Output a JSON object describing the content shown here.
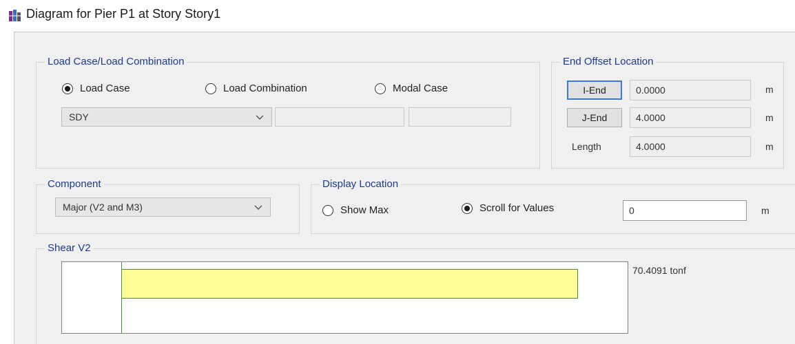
{
  "window": {
    "title": "Diagram for Pier P1 at Story Story1",
    "icon": "etabs-app-icon"
  },
  "load_case_group": {
    "legend": "Load Case/Load Combination",
    "options": [
      {
        "label": "Load Case",
        "selected": true
      },
      {
        "label": "Load Combination",
        "selected": false
      },
      {
        "label": "Modal Case",
        "selected": false
      }
    ],
    "case_select": {
      "value": "SDY"
    },
    "combo_field": {
      "value": ""
    },
    "modal_field": {
      "value": ""
    }
  },
  "end_offset": {
    "legend": "End Offset Location",
    "i_end": {
      "button": "I-End",
      "value": "0.0000",
      "unit": "m"
    },
    "j_end": {
      "button": "J-End",
      "value": "4.0000",
      "unit": "m"
    },
    "length": {
      "label": "Length",
      "value": "4.0000",
      "unit": "m"
    }
  },
  "component": {
    "legend": "Component",
    "value": "Major (V2 and M3)"
  },
  "display_location": {
    "legend": "Display Location",
    "options": [
      {
        "label": "Show Max",
        "selected": false
      },
      {
        "label": "Scroll for Values",
        "selected": true
      }
    ],
    "location_value": "0",
    "unit": "m"
  },
  "shear": {
    "legend": "Shear V2",
    "value_text": "70.4091 tonf",
    "bar_color": "#ffff99",
    "line_color": "#4d8a3a"
  }
}
